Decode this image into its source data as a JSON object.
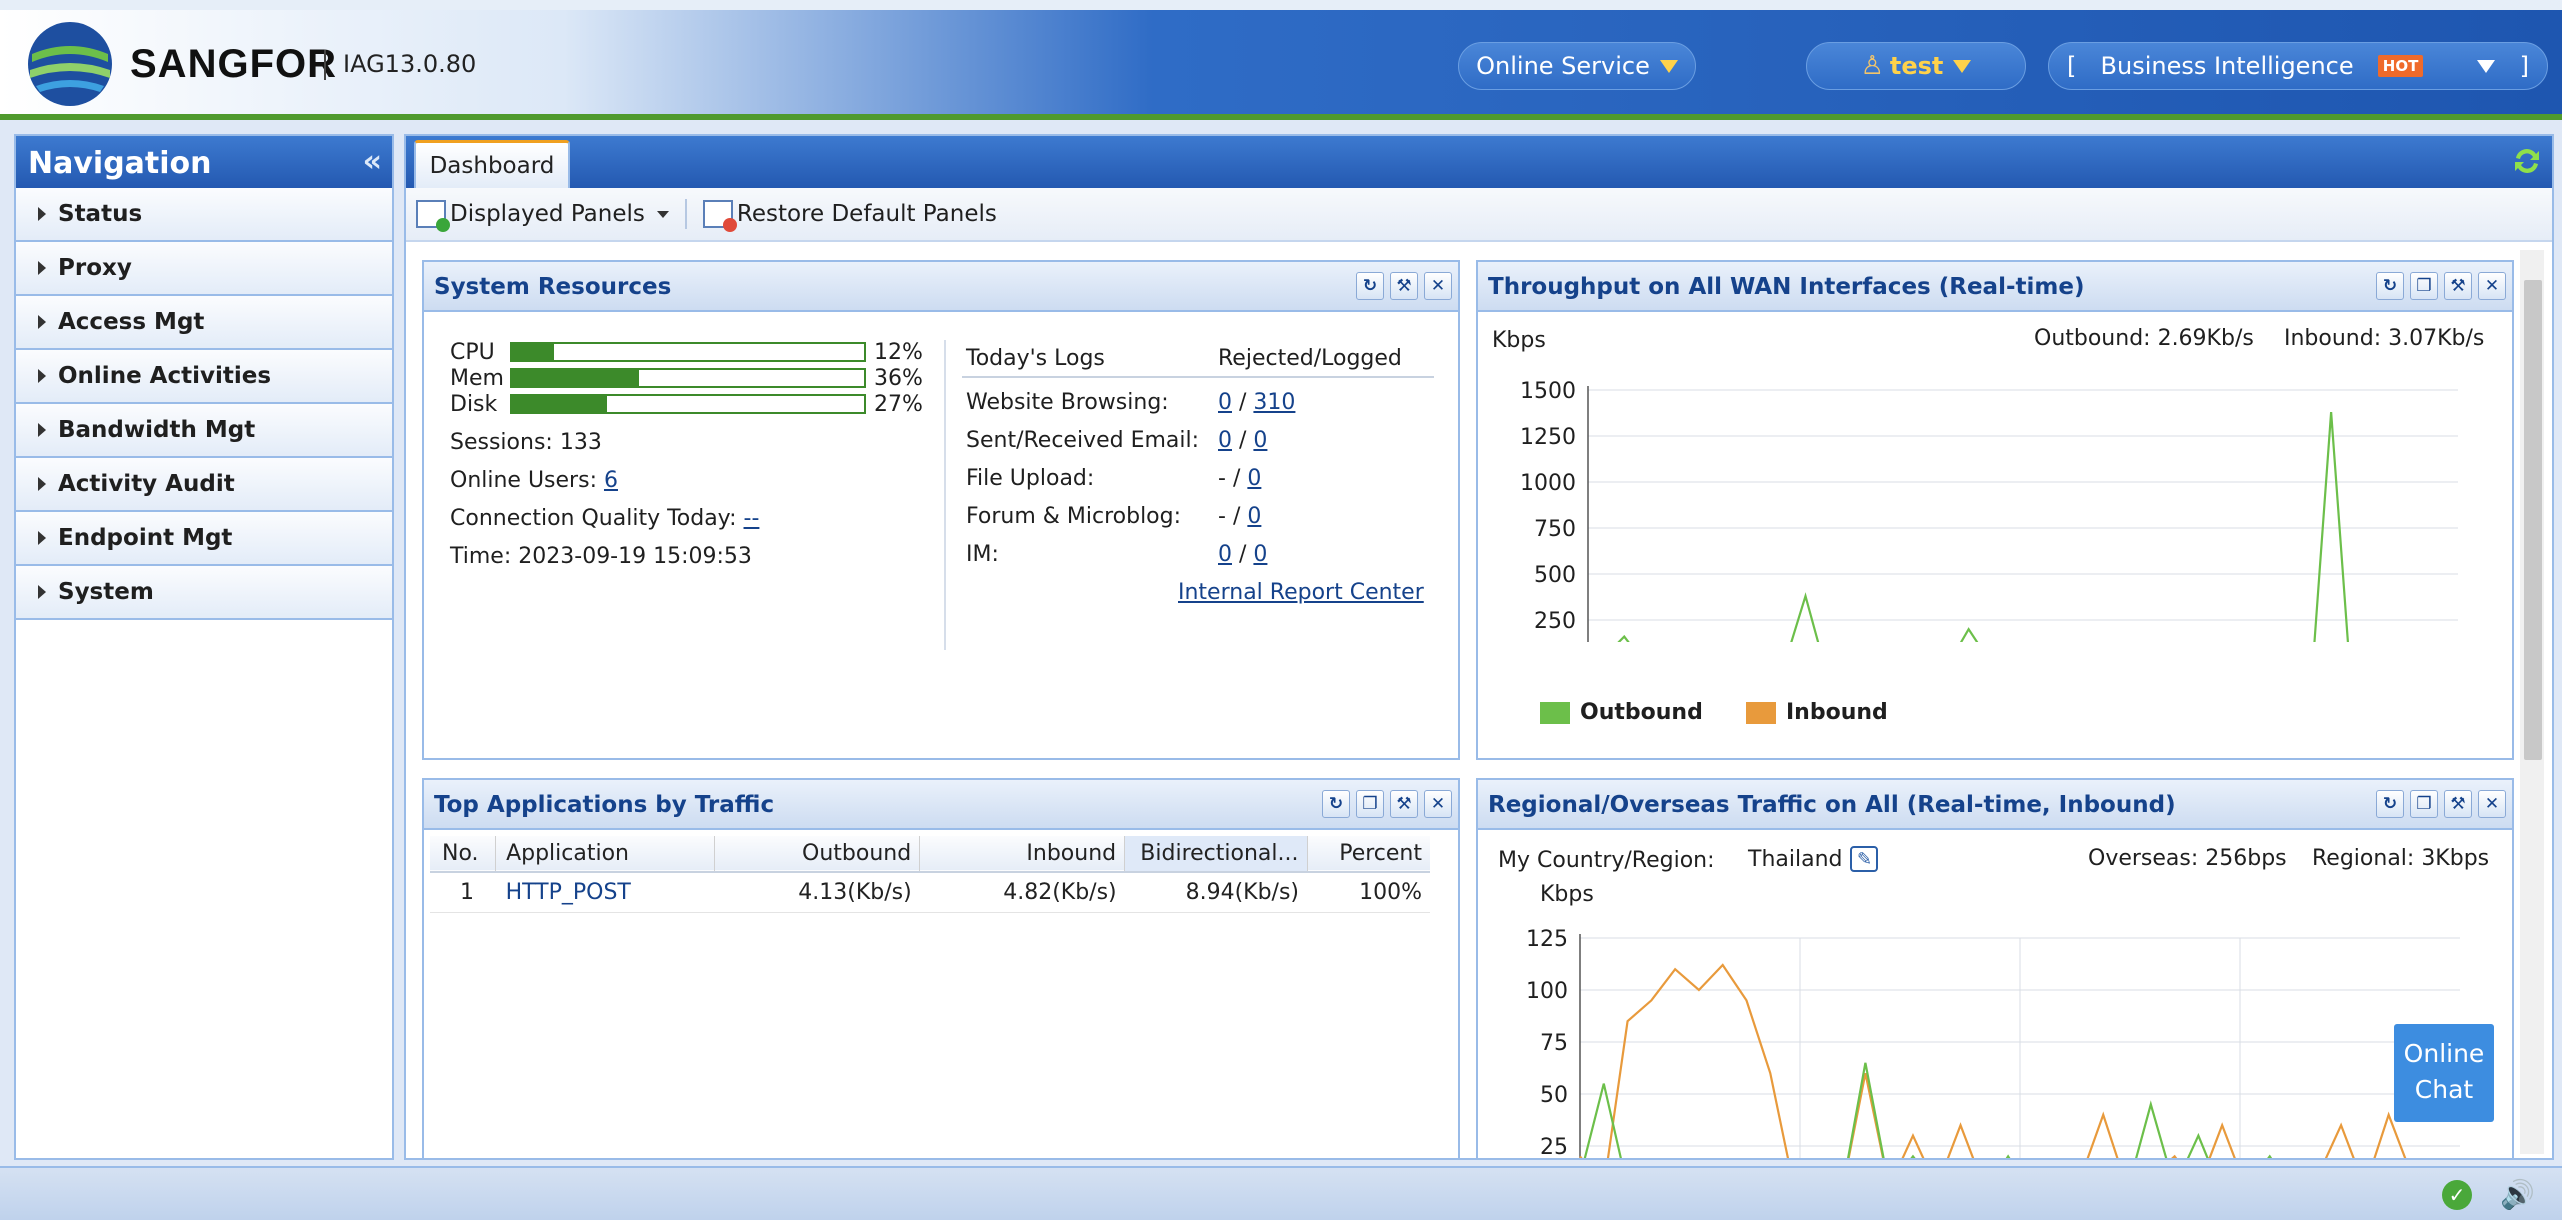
{
  "header": {
    "brand": "SANGFOR",
    "version": "IAG13.0.80",
    "online_service": "Online Service",
    "user": "test",
    "bi_open": "[",
    "bi_label": "Business Intelligence",
    "bi_badge": "HOT",
    "bi_close": "]"
  },
  "nav": {
    "title": "Navigation",
    "collapse": "«",
    "items": [
      "Status",
      "Proxy",
      "Access Mgt",
      "Online Activities",
      "Bandwidth Mgt",
      "Activity Audit",
      "Endpoint Mgt",
      "System"
    ]
  },
  "tabs": {
    "dashboard": "Dashboard"
  },
  "toolbar": {
    "displayed_panels": "Displayed Panels",
    "restore": "Restore Default Panels"
  },
  "system_resources": {
    "title": "System Resources",
    "cpu_label": "CPU",
    "cpu_pct": "12%",
    "cpu": 0.12,
    "mem_label": "Mem",
    "mem_pct": "36%",
    "mem": 0.36,
    "disk_label": "Disk",
    "disk_pct": "27%",
    "disk": 0.27,
    "sessions_label": "Sessions:",
    "sessions": "133",
    "online_users_label": "Online Users:",
    "online_users": "6",
    "conn_quality_label": "Connection Quality Today:",
    "conn_quality": "--",
    "time_label": "Time:",
    "time": "2023-09-19 15:09:53",
    "logs_header": "Today's Logs",
    "logs_header2": "Rejected/Logged",
    "logs": [
      {
        "label": "Website Browsing:",
        "rejected": "0",
        "logged": "310"
      },
      {
        "label": "Sent/Received Email:",
        "rejected": "0",
        "logged": "0"
      },
      {
        "label": "File Upload:",
        "rejected": "-",
        "logged": "0"
      },
      {
        "label": "Forum & Microblog:",
        "rejected": "-",
        "logged": "0"
      },
      {
        "label": "IM:",
        "rejected": "0",
        "logged": "0"
      }
    ],
    "slash": "/",
    "report_link": "Internal Report Center"
  },
  "throughput": {
    "title": "Throughput on All WAN Interfaces (Real-time)",
    "unit": "Kbps",
    "outbound_label": "Outbound: 2.69Kb/s",
    "inbound_label": "Inbound: 3.07Kb/s",
    "legend_out": "Outbound",
    "legend_in": "Inbound",
    "color_out": "#6cbf4a",
    "color_in": "#e89a3c"
  },
  "top_apps": {
    "title": "Top Applications by Traffic",
    "columns": [
      "No.",
      "Application",
      "Outbound",
      "Inbound",
      "Bidirectional...",
      "Percent"
    ],
    "rows": [
      {
        "no": "1",
        "app": "HTTP_POST",
        "out": "4.13(Kb/s)",
        "in": "4.82(Kb/s)",
        "bi": "8.94(Kb/s)",
        "pct": "100%"
      }
    ]
  },
  "regional": {
    "title": "Regional/Overseas Traffic on All (Real-time, Inbound)",
    "country_label": "My Country/Region:",
    "country": "Thailand",
    "overseas": "Overseas: 256bps",
    "regional": "Regional: 3Kbps",
    "unit": "Kbps"
  },
  "chat": {
    "line1": "Online",
    "line2": "Chat"
  },
  "chart_data": [
    {
      "type": "line",
      "title": "Throughput on All WAN Interfaces (Real-time)",
      "ylabel": "Kbps",
      "ylim": [
        0,
        1500
      ],
      "yticks": [
        "0",
        "250",
        "500",
        "750",
        "1000",
        "1250",
        "1500"
      ],
      "xticks": [
        "16:06",
        "16:07",
        "16:08",
        "16:09"
      ],
      "legend": "bottom-left",
      "grid": true,
      "series": [
        {
          "name": "Outbound",
          "color": "#6cbf4a",
          "values": [
            10,
            60,
            160,
            30,
            50,
            90,
            100,
            110,
            100,
            100,
            80,
            60,
            380,
            20,
            30,
            40,
            100,
            20,
            30,
            40,
            30,
            200,
            50,
            20,
            30,
            40,
            60,
            120,
            20,
            30,
            70,
            20,
            40,
            30,
            20,
            30,
            40,
            20,
            30,
            60,
            20,
            1380,
            30,
            20,
            40,
            60,
            20,
            60,
            20
          ]
        },
        {
          "name": "Inbound",
          "color": "#e89a3c",
          "values": [
            5,
            30,
            100,
            20,
            40,
            70,
            90,
            100,
            120,
            90,
            70,
            50,
            40,
            30,
            20,
            30,
            90,
            20,
            30,
            20,
            20,
            30,
            40,
            20,
            30,
            20,
            40,
            80,
            20,
            30,
            30,
            20,
            20,
            20,
            20,
            20,
            30,
            20,
            20,
            40,
            20,
            30,
            20,
            20,
            20,
            30,
            20,
            20,
            20
          ]
        }
      ]
    },
    {
      "type": "line",
      "title": "Regional/Overseas Traffic on All (Real-time, Inbound)",
      "ylabel": "Kbps",
      "ylim": [
        0,
        125
      ],
      "yticks": [
        "25",
        "50",
        "75",
        "100",
        "125"
      ],
      "grid": true,
      "series": [
        {
          "name": "Regional",
          "color": "#e89a3c",
          "values": [
            20,
            5,
            85,
            95,
            110,
            100,
            112,
            95,
            60,
            5,
            3,
            2,
            60,
            5,
            30,
            5,
            35,
            5,
            3,
            5,
            3,
            8,
            40,
            5,
            10,
            20,
            5,
            35,
            5,
            2,
            2,
            10,
            35,
            5,
            40,
            10,
            2,
            2
          ]
        },
        {
          "name": "Overseas",
          "color": "#6cbf4a",
          "values": [
            10,
            55,
            5,
            2,
            3,
            2,
            5,
            3,
            5,
            3,
            5,
            2,
            65,
            5,
            20,
            5,
            5,
            3,
            20,
            2,
            3,
            5,
            5,
            3,
            45,
            5,
            30,
            2,
            5,
            20,
            3,
            2,
            5,
            3,
            5,
            10,
            3,
            10
          ]
        }
      ]
    }
  ]
}
